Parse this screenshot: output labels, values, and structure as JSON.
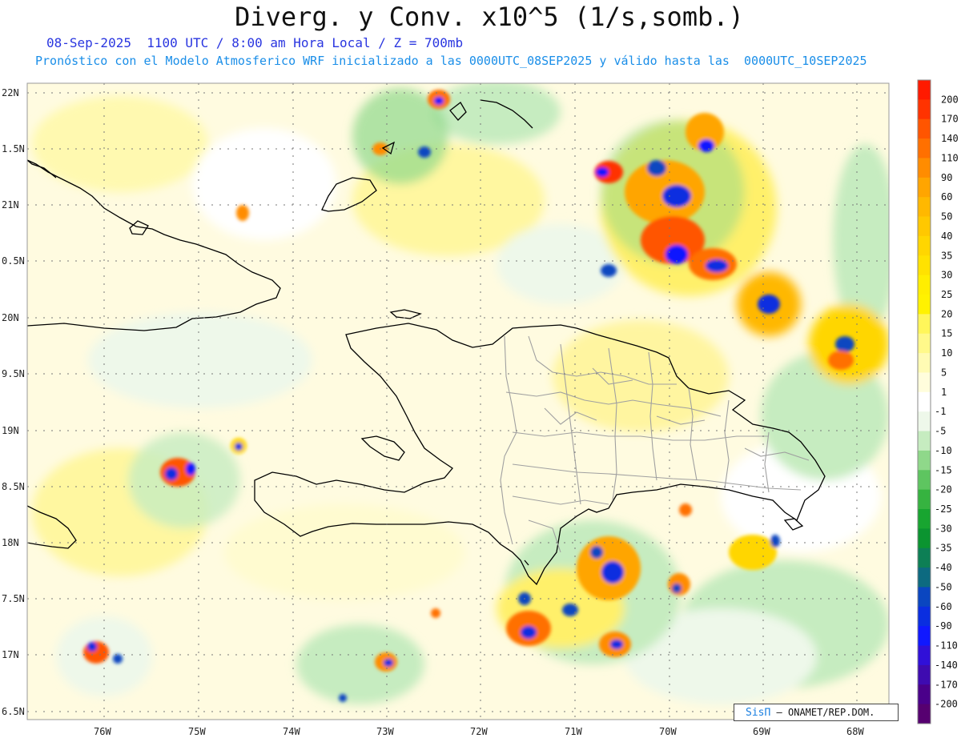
{
  "header": {
    "title": "Diverg. y Conv. x10^5 (1/s,somb.)",
    "subtitle_1": "08-Sep-2025  1100 UTC / 8:00 am Hora Local / Z = 700mb",
    "subtitle_2": "Pronóstico con el Modelo Atmosferico WRF inicializado a las 0000UTC_08SEP2025 y válido hasta las  0000UTC_10SEP2025"
  },
  "axes": {
    "lat_labels": [
      "22N",
      "1.5N",
      "21N",
      "0.5N",
      "20N",
      "9.5N",
      "19N",
      "8.5N",
      "18N",
      "7.5N",
      "17N",
      "6.5N"
    ],
    "lon_labels": [
      "76W",
      "75W",
      "74W",
      "73W",
      "72W",
      "71W",
      "70W",
      "69W",
      "68W"
    ]
  },
  "colorbar": {
    "labels": [
      "200",
      "170",
      "140",
      "110",
      "90",
      "60",
      "50",
      "40",
      "35",
      "30",
      "25",
      "20",
      "15",
      "10",
      "5",
      "1",
      "-1",
      "-5",
      "-10",
      "-15",
      "-20",
      "-25",
      "-30",
      "-35",
      "-40",
      "-50",
      "-60",
      "-90",
      "-110",
      "-140",
      "-170",
      "-200"
    ],
    "colors": [
      "#ff1a00",
      "#ff3300",
      "#ff5500",
      "#ff7000",
      "#ff8c00",
      "#ffa500",
      "#ffb800",
      "#ffc800",
      "#ffd600",
      "#ffe200",
      "#ffee00",
      "#fff200",
      "#fff65a",
      "#fff98a",
      "#fffbb4",
      "#fffddc",
      "#ffffff",
      "#eef8ea",
      "#c6ecc0",
      "#8fd88a",
      "#5ec560",
      "#36b340",
      "#18a530",
      "#0b9430",
      "#0d7f55",
      "#0d6a80",
      "#0a46c0",
      "#0a2ee0",
      "#1018ff",
      "#3010d8",
      "#3e0bb0",
      "#4a008a",
      "#560070"
    ]
  },
  "credit": {
    "logo": "SisΠ",
    "text": "– ONAMET/REP.DOM."
  },
  "map": {
    "features": [
      "cuba-coast",
      "hispaniola-coast",
      "bahamas-islands",
      "turks-caicos",
      "jamaica-coast",
      "dominican-provinces"
    ]
  }
}
